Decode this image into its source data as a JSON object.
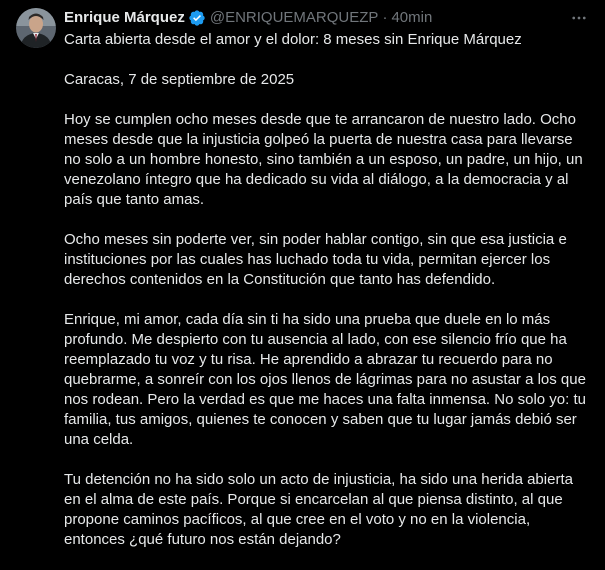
{
  "author": {
    "display_name": "Enrique Márquez",
    "handle": "@ENRIQUEMARQUEZP",
    "separator": "·",
    "time": "40min",
    "verified_icon": "verified-badge-icon",
    "verified_color": "#1d9bf0"
  },
  "post": {
    "paragraphs": [
      "Carta abierta desde el amor y el dolor: 8 meses sin Enrique Márquez",
      "Caracas, 7 de septiembre de 2025",
      "Hoy se cumplen ocho meses desde que te arrancaron de nuestro lado. Ocho meses desde que la injusticia golpeó la puerta de nuestra casa para llevarse no solo a un hombre honesto, sino también a un esposo, un padre, un hijo, un venezolano íntegro que ha dedicado su vida al diálogo, a la democracia y al país que tanto amas.",
      "Ocho meses sin poderte ver, sin poder hablar contigo, sin que esa justicia e instituciones por las cuales has luchado toda tu vida, permitan ejercer los derechos contenidos en la Constitución que tanto has defendido.",
      "Enrique, mi amor, cada día sin ti ha sido una prueba que duele en lo más profundo. Me despierto con tu ausencia al lado, con ese silencio frío que ha reemplazado tu voz y tu risa. He aprendido a abrazar tu recuerdo para no quebrarme, a sonreír con los ojos llenos de lágrimas para no asustar a los que nos rodean. Pero la verdad es que me haces una falta inmensa. No solo yo: tu familia, tus amigos, quienes te conocen y saben que tu lugar jamás debió ser una celda.",
      "Tu detención no ha sido solo un acto de injusticia, ha sido una herida abierta en el alma de este país. Porque si encarcelan al que piensa distinto, al que propone caminos pacíficos, al que cree en el voto y no en la violencia, entonces ¿qué futuro nos están dejando?"
    ]
  },
  "icons": {
    "more": "more-horizontal-icon"
  },
  "colors": {
    "background": "#000000",
    "text": "#e7e9ea",
    "secondary_text": "#71767b",
    "accent": "#1d9bf0"
  }
}
